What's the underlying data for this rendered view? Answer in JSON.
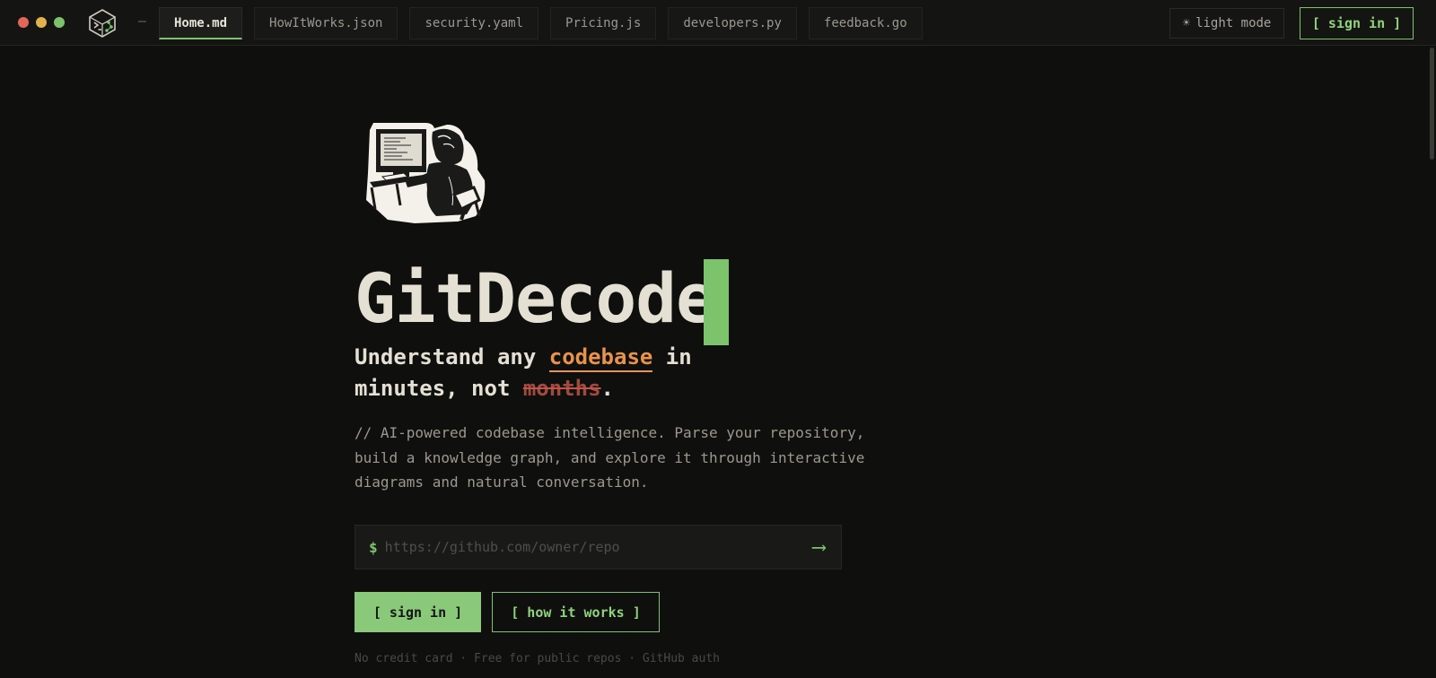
{
  "window": {
    "controls": [
      {
        "name": "close",
        "color": "#e0675a"
      },
      {
        "name": "minimize",
        "color": "#e3b04b"
      },
      {
        "name": "maximize",
        "color": "#7cc36b"
      }
    ],
    "logo_icon": "terminal-cube-logo-icon",
    "separator": "—"
  },
  "tabs": [
    {
      "label": "Home.md",
      "active": true
    },
    {
      "label": "HowItWorks.json",
      "active": false
    },
    {
      "label": "security.yaml",
      "active": false
    },
    {
      "label": "Pricing.js",
      "active": false
    },
    {
      "label": "developers.py",
      "active": false
    },
    {
      "label": "feedback.go",
      "active": false
    }
  ],
  "header": {
    "theme_toggle": {
      "icon": "sun-icon",
      "glyph": "☀",
      "label": "light mode"
    },
    "signin_label": "[ sign in ]"
  },
  "hero": {
    "illustration_icon": "developer-at-computer-illustration",
    "title": "GitDecode",
    "tagline": {
      "line1_before": "Understand any ",
      "highlight": "codebase",
      "line1_after": " in",
      "line2_before": "minutes, not ",
      "struck": "months",
      "line2_after": "."
    },
    "description": "// AI-powered codebase intelligence. Parse your repository, build a knowledge graph, and explore it through interactive diagrams and natural conversation.",
    "repo_input": {
      "prompt": "$",
      "placeholder": "https://github.com/owner/repo",
      "value": "",
      "submit_glyph": "⟶"
    },
    "primary_cta": "[ sign in ]",
    "secondary_cta": "[ how it works ]",
    "footnote": "No credit card · Free for public repos · GitHub auth"
  },
  "colors": {
    "accent": "#7cc36b",
    "highlight": "#e8924a",
    "strike": "#a04a3f",
    "background": "#0f0f0e"
  }
}
